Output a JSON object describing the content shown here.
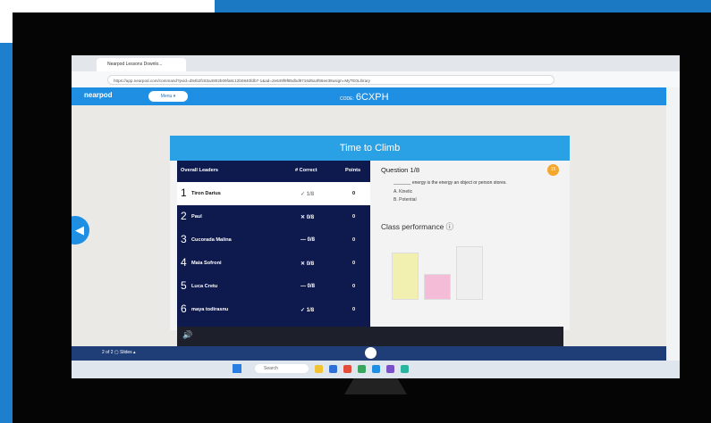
{
  "browser": {
    "tab_title": "Nearpod Lessons Downlo...",
    "url": "https://app.nearpod.com/command?pvid=d94b2fc63a4802b09fa8c12b0840fdb7-1&ad=2e649f9f85dbd9716d6a4f66ee38usign=MyTE0Library"
  },
  "nearpod": {
    "logo": "nearpod",
    "menu_label": "Menu ▾",
    "code_prefix": "CODE:",
    "code": "6CXPH"
  },
  "activity": {
    "title": "Time to Climb",
    "headers": {
      "leaders": "Overall Leaders",
      "correct": "# Correct",
      "points": "Points"
    },
    "leaders": [
      {
        "rank": "1",
        "name": "Tiron Darius",
        "score": "✓ 1/8",
        "points": "0"
      },
      {
        "rank": "2",
        "name": "Paul",
        "score": "✕ 0/8",
        "points": "0"
      },
      {
        "rank": "3",
        "name": "Cucorada Malina",
        "score": "— 0/8",
        "points": "0"
      },
      {
        "rank": "4",
        "name": "Maia Sofroni",
        "score": "✕ 0/8",
        "points": "0"
      },
      {
        "rank": "5",
        "name": "Luca Cretu",
        "score": "— 0/8",
        "points": "0"
      },
      {
        "rank": "6",
        "name": "maya todirasnu",
        "score": "✓ 1/8",
        "points": "0"
      }
    ],
    "question": {
      "title": "Question 1/8",
      "badge": "15",
      "text": "_______ energy is the energy an object or person stores.",
      "options": [
        "A.  Kinetic",
        "B.  Potential"
      ]
    },
    "class_performance": "Class performance ⓘ",
    "bars": [
      {
        "value": 0.75,
        "color": "#f2f0b0"
      },
      {
        "value": 0.42,
        "color": "#f4bcd6"
      },
      {
        "value": 0.85,
        "color": "#efefef"
      }
    ]
  },
  "bottom": {
    "slides_label": "2 of 2   ▢  Slides ▴"
  },
  "taskbar": {
    "search_placeholder": "Search"
  }
}
